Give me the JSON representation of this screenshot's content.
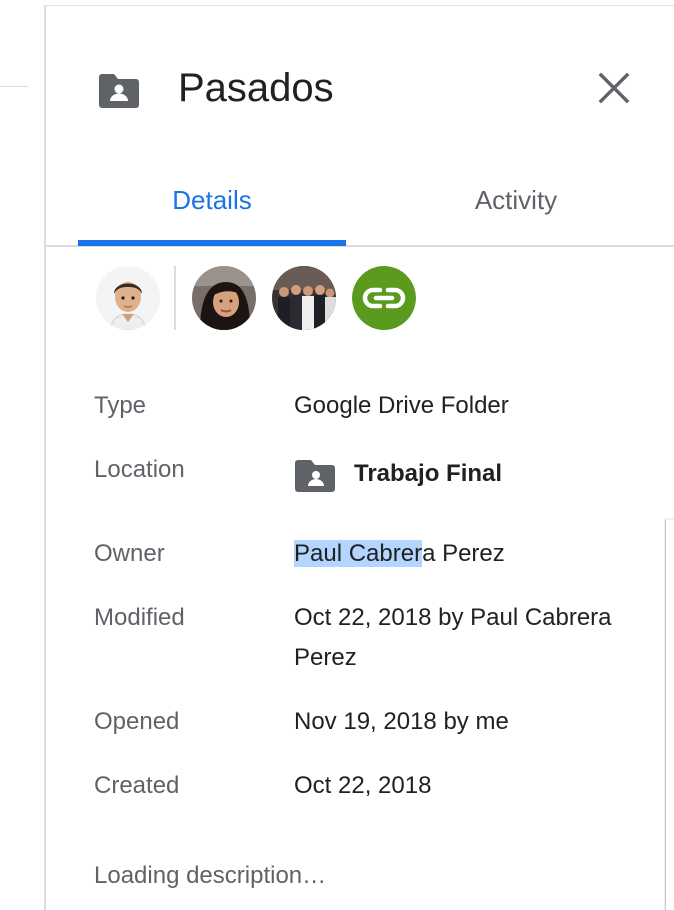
{
  "header": {
    "title": "Pasados",
    "folder_icon": "shared-folder-icon",
    "close_icon": "close-icon"
  },
  "tabs": [
    {
      "label": "Details",
      "active": true
    },
    {
      "label": "Activity",
      "active": false
    }
  ],
  "colors": {
    "accent": "#1a73e8",
    "link_avatar_bg": "#5a9a1e",
    "selection": "#b4d5fe"
  },
  "avatars": [
    {
      "name": "owner-avatar",
      "icon": "person-photo"
    },
    {
      "name": "shared-user-avatar-1",
      "icon": "person-photo"
    },
    {
      "name": "shared-user-avatar-2",
      "icon": "group-photo"
    },
    {
      "name": "link-sharing-avatar",
      "icon": "link-icon"
    }
  ],
  "details": {
    "type": {
      "label": "Type",
      "value": "Google Drive Folder"
    },
    "location": {
      "label": "Location",
      "value": "Trabajo Final",
      "icon": "shared-folder-icon"
    },
    "owner": {
      "label": "Owner",
      "value_selected": "Paul Cabrer",
      "value_rest": "a Perez"
    },
    "modified": {
      "label": "Modified",
      "value": "Oct 22, 2018 by Paul Cabrera Perez"
    },
    "opened": {
      "label": "Opened",
      "value": "Nov 19, 2018 by me"
    },
    "created": {
      "label": "Created",
      "value": "Oct 22, 2018"
    }
  },
  "description": {
    "loading_text": "Loading description…"
  }
}
